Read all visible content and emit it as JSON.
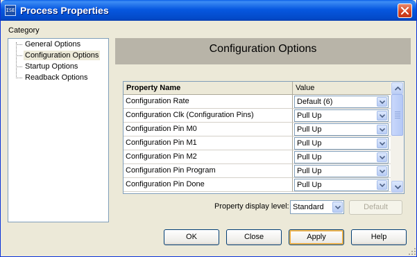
{
  "window": {
    "title": "Process Properties",
    "app_icon_text": "ISE"
  },
  "category": {
    "label": "Category",
    "items": [
      {
        "label": "General Options",
        "selected": false
      },
      {
        "label": "Configuration Options",
        "selected": true
      },
      {
        "label": "Startup Options",
        "selected": false
      },
      {
        "label": "Readback Options",
        "selected": false
      }
    ]
  },
  "header": {
    "title": "Configuration Options"
  },
  "grid": {
    "columns": [
      "Property Name",
      "Value"
    ],
    "rows": [
      {
        "name": "Configuration Rate",
        "value": "Default (6)"
      },
      {
        "name": "Configuration Clk (Configuration Pins)",
        "value": "Pull Up"
      },
      {
        "name": "Configuration Pin M0",
        "value": "Pull Up"
      },
      {
        "name": "Configuration Pin M1",
        "value": "Pull Up"
      },
      {
        "name": "Configuration Pin M2",
        "value": "Pull Up"
      },
      {
        "name": "Configuration Pin Program",
        "value": "Pull Up"
      },
      {
        "name": "Configuration Pin Done",
        "value": "Pull Up"
      }
    ]
  },
  "display_level": {
    "label": "Property display level:",
    "value": "Standard",
    "default_button": "Default"
  },
  "buttons": {
    "ok": "OK",
    "close": "Close",
    "apply": "Apply",
    "help": "Help"
  },
  "icons": [
    "app-icon",
    "close-icon",
    "chevron-down-icon",
    "scroll-up-icon",
    "scroll-down-icon",
    "resize-grip-icon"
  ],
  "colors": {
    "titlebar": "#0758e0",
    "header_panel": "#b8b4a8",
    "dialog_bg": "#ece9d8",
    "selection_bg": "#ece9d8"
  }
}
